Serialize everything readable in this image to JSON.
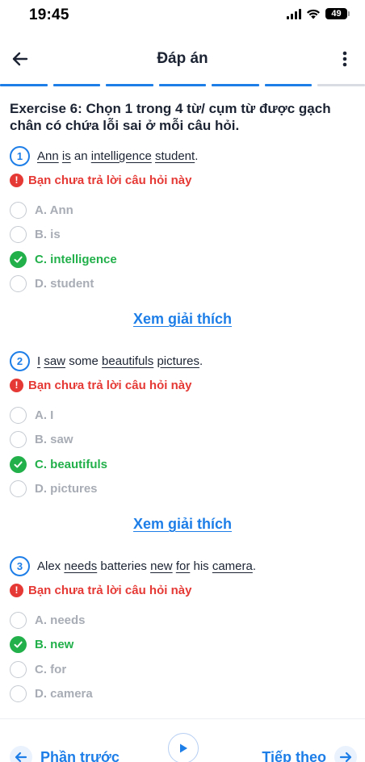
{
  "status": {
    "time": "19:45",
    "battery": "49"
  },
  "header": {
    "title": "Đáp án"
  },
  "progress": {
    "segments_total": 7,
    "segments_done": 6
  },
  "exercise": {
    "title": "Exercise 6: Chọn 1 trong 4 từ/ cụm từ được gạch chân có chứa lỗi sai ở mỗi câu hỏi."
  },
  "warning_text": "Bạn chưa trả lời câu hỏi này",
  "explain_label": "Xem giải thích",
  "questions": [
    {
      "number": "1",
      "parts": [
        "Ann",
        " ",
        "is",
        " an ",
        "intelligence",
        " ",
        "student",
        "."
      ],
      "options": [
        "A. Ann",
        "B. is",
        "C. intelligence",
        "D. student"
      ],
      "correct": 2
    },
    {
      "number": "2",
      "parts": [
        "I",
        " ",
        "saw",
        " some ",
        "beautifuls",
        " ",
        "pictures",
        "."
      ],
      "options": [
        "A. I",
        "B. saw",
        "C. beautifuls",
        "D. pictures"
      ],
      "correct": 2
    },
    {
      "number": "3",
      "parts": [
        "Alex ",
        "needs",
        " batteries ",
        "new",
        " ",
        "for",
        " his ",
        "camera",
        "."
      ],
      "options": [
        "A. needs",
        "B. new",
        "C. for",
        "D. camera"
      ],
      "correct": 1
    }
  ],
  "footer": {
    "prev_label": "Phần trước",
    "next_label": "Tiếp theo"
  },
  "colors": {
    "accent": "#1e7ee8",
    "correct": "#22b04b",
    "error": "#e53935"
  }
}
